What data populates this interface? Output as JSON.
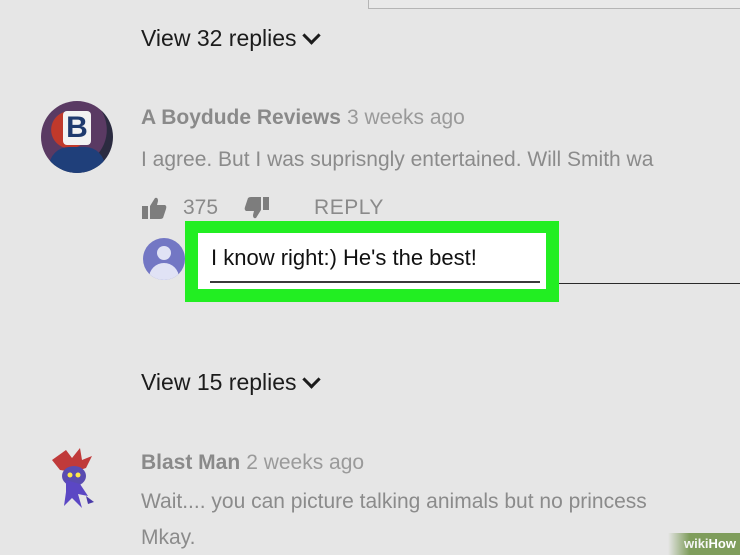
{
  "thread1": {
    "view_replies": "View 32 replies"
  },
  "comment1": {
    "author": "A Boydude Reviews",
    "time": "3 weeks ago",
    "text": "I agree. But I was suprisngly entertained. Will Smith wa",
    "likes": "375",
    "reply_label": "REPLY",
    "avatar_letter": "B"
  },
  "reply_box": {
    "value": "I know right:) He's the best!"
  },
  "thread2": {
    "view_replies": "View 15 replies"
  },
  "comment2": {
    "author": "Blast Man",
    "time": "2 weeks ago",
    "text_line1": "Wait.... you can picture talking animals but no princess",
    "text_line2": "Mkay."
  },
  "watermark": {
    "wiki": "wiki",
    "how": "How"
  },
  "colors": {
    "highlight": "#22ee22",
    "avatar_user": "#7377c4"
  }
}
